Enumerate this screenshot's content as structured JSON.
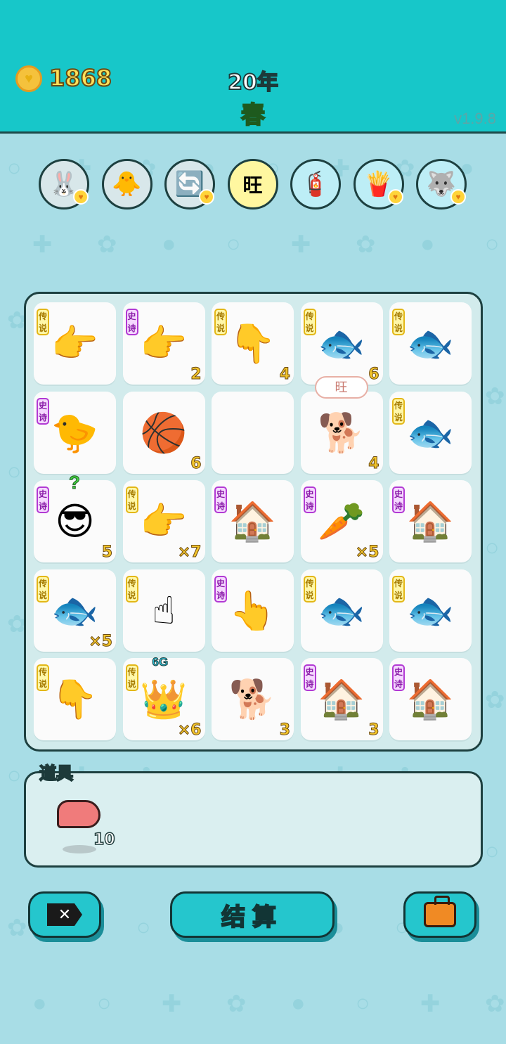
{
  "header": {
    "coins": "1868",
    "coin_icon": "heart-coin-icon",
    "year": "20年",
    "season": "春",
    "version": "v1.9.8"
  },
  "buffs": [
    {
      "icon": "rabbit-icon",
      "glyph": "🐰",
      "has_heart": true
    },
    {
      "icon": "chick-egg-icon",
      "glyph": "🐥",
      "has_heart": false
    },
    {
      "icon": "refresh-icon",
      "glyph": "🔄",
      "has_heart": true
    },
    {
      "icon": "wang-text-icon",
      "glyph": "旺",
      "has_heart": false
    },
    {
      "icon": "pump-icon",
      "glyph": "🧯",
      "has_heart": false
    },
    {
      "icon": "fries-icon",
      "glyph": "🍟",
      "has_heart": true
    },
    {
      "icon": "husky-icon",
      "glyph": "🐺",
      "has_heart": true
    }
  ],
  "board": [
    {
      "icon": "pointing-hand-icon",
      "glyph": "👉",
      "rarity": "传说",
      "rarity_type": "legend",
      "count": ""
    },
    {
      "icon": "pointing-hand-gray-icon",
      "glyph": "👉",
      "rarity": "史诗",
      "rarity_type": "epic",
      "count": "2"
    },
    {
      "icon": "pointing-down-hand-icon",
      "glyph": "👇",
      "rarity": "传说",
      "rarity_type": "legend",
      "count": "4"
    },
    {
      "icon": "koi-fish-icon",
      "glyph": "🐟",
      "rarity": "传说",
      "rarity_type": "legend",
      "count": "6"
    },
    {
      "icon": "koi-fish-icon",
      "glyph": "🐟",
      "rarity": "传说",
      "rarity_type": "legend",
      "count": ""
    },
    {
      "icon": "gray-hair-chick-icon",
      "glyph": "🐤",
      "rarity": "史诗",
      "rarity_type": "epic",
      "count": ""
    },
    {
      "icon": "basketball-dog-icon",
      "glyph": "🏀",
      "rarity": "",
      "rarity_type": "",
      "count": "6"
    },
    {
      "icon": "empty-cell",
      "glyph": "",
      "rarity": "",
      "rarity_type": "",
      "count": ""
    },
    {
      "icon": "husky-dog-icon",
      "glyph": "🐕",
      "rarity": "",
      "rarity_type": "",
      "count": "4",
      "bubble": "旺"
    },
    {
      "icon": "koi-fish-icon",
      "glyph": "🐟",
      "rarity": "传说",
      "rarity_type": "legend",
      "count": ""
    },
    {
      "icon": "green-cap-man-icon",
      "glyph": "😎",
      "rarity": "史诗",
      "rarity_type": "epic",
      "count": "5",
      "question": "?"
    },
    {
      "icon": "pointing-hand-icon",
      "glyph": "👉",
      "rarity": "传说",
      "rarity_type": "legend",
      "count": "×7"
    },
    {
      "icon": "rabbit-house-icon",
      "glyph": "🏠",
      "rarity": "史诗",
      "rarity_type": "epic",
      "count": ""
    },
    {
      "icon": "carrot-icon",
      "glyph": "🥕",
      "rarity": "史诗",
      "rarity_type": "epic",
      "count": "×5"
    },
    {
      "icon": "rabbit-house-icon",
      "glyph": "🏠",
      "rarity": "史诗",
      "rarity_type": "epic",
      "count": ""
    },
    {
      "icon": "koi-fish-icon",
      "glyph": "🐟",
      "rarity": "传说",
      "rarity_type": "legend",
      "count": "×5"
    },
    {
      "icon": "pointing-up-hand-icon",
      "glyph": "☝",
      "rarity": "传说",
      "rarity_type": "legend",
      "count": ""
    },
    {
      "icon": "pointing-hand-gray-icon",
      "glyph": "👆",
      "rarity": "史诗",
      "rarity_type": "epic",
      "count": ""
    },
    {
      "icon": "koi-fish-icon",
      "glyph": "🐟",
      "rarity": "传说",
      "rarity_type": "legend",
      "count": ""
    },
    {
      "icon": "koi-fish-icon",
      "glyph": "🐟",
      "rarity": "传说",
      "rarity_type": "legend",
      "count": ""
    },
    {
      "icon": "pointing-down-hand-icon",
      "glyph": "👇",
      "rarity": "传说",
      "rarity_type": "legend",
      "count": ""
    },
    {
      "icon": "crowned-husky-icon",
      "glyph": "👑",
      "rarity": "传说",
      "rarity_type": "legend",
      "count": "×6",
      "tag": "6G"
    },
    {
      "icon": "husky-dog-icon",
      "glyph": "🐕",
      "rarity": "",
      "rarity_type": "",
      "count": "3"
    },
    {
      "icon": "rabbit-house-icon",
      "glyph": "🏠",
      "rarity": "史诗",
      "rarity_type": "epic",
      "count": "3"
    },
    {
      "icon": "rabbit-house-icon",
      "glyph": "🏠",
      "rarity": "史诗",
      "rarity_type": "epic",
      "count": ""
    }
  ],
  "items": {
    "label": "道具",
    "list": [
      {
        "icon": "liver-icon",
        "count": "10"
      }
    ]
  },
  "buttons": {
    "exit_icon": "exit-icon",
    "exit_glyph": "✕",
    "settle_label": "结算",
    "bag_icon": "briefcase-icon"
  }
}
